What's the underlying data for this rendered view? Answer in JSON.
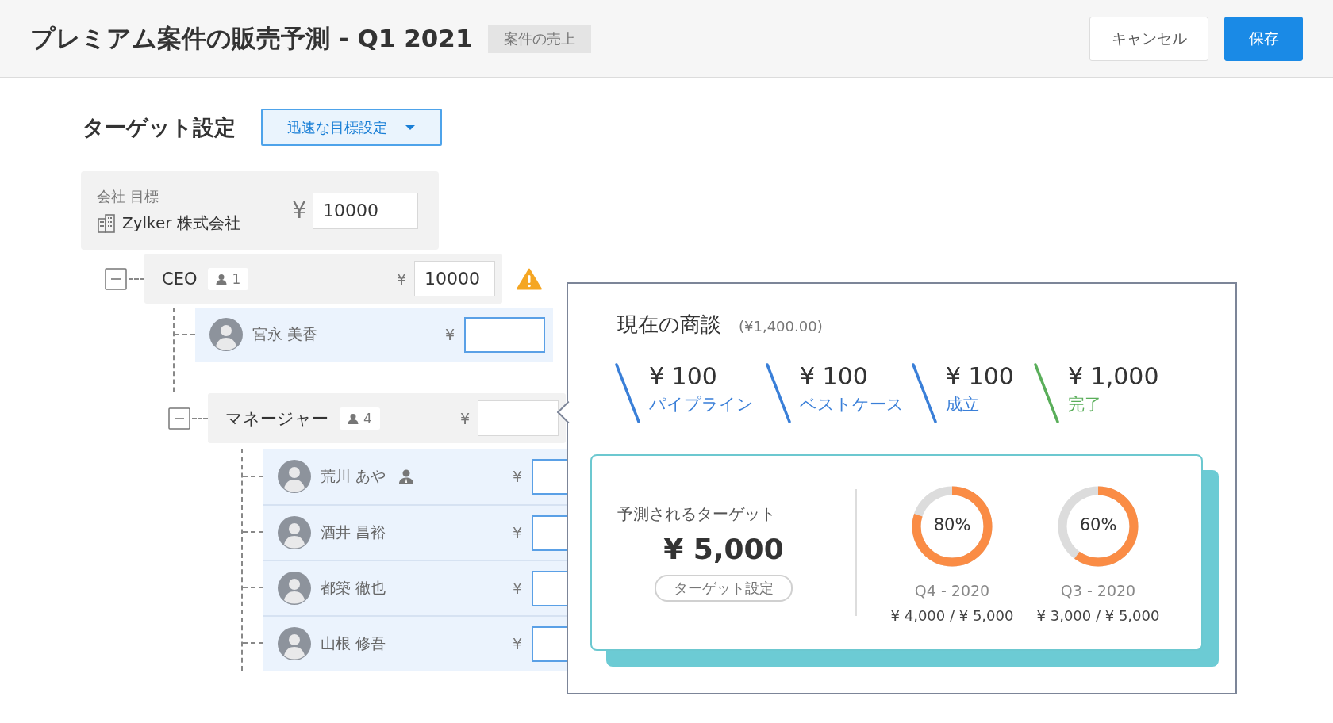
{
  "header": {
    "title": "プレミアム案件の販売予測 - Q1 2021",
    "tag": "案件の売上",
    "buttons": [
      {
        "label": "キャンセル",
        "kind": "secondary"
      },
      {
        "label": "保存",
        "kind": "primary"
      }
    ]
  },
  "target_section": {
    "title": "ターゲット設定",
    "quick_set": "迅速な目標設定"
  },
  "company": {
    "label": "会社 目標",
    "name": "Zylker 株式会社",
    "currency": "¥",
    "value": "10000"
  },
  "tree": [
    {
      "kind": "role",
      "name": "CEO",
      "count": "1",
      "currency": "¥",
      "value": "10000",
      "warning": true,
      "expanded": true,
      "children": [
        {
          "kind": "user",
          "name": "宮永 美香",
          "currency": "¥",
          "lead": false
        },
        {
          "kind": "role",
          "name": "マネージャー",
          "count": "4",
          "currency": "¥",
          "warning": false,
          "expanded": true,
          "children": [
            {
              "kind": "user",
              "name": "荒川 あや",
              "currency": "¥",
              "lead": true
            },
            {
              "kind": "user",
              "name": "酒井 昌裕",
              "currency": "¥",
              "lead": false
            },
            {
              "kind": "user",
              "name": "都築 徹也",
              "currency": "¥",
              "lead": false
            },
            {
              "kind": "user",
              "name": "山根 修吾",
              "currency": "¥",
              "lead": false
            }
          ]
        }
      ]
    }
  ],
  "popover": {
    "title": "現在の商談",
    "total": "(¥1,400.00)",
    "stats": [
      {
        "amount": "¥ 100",
        "label": "パイプライン",
        "color": "#3a7fd8"
      },
      {
        "amount": "¥ 100",
        "label": "ベストケース",
        "color": "#3a7fd8"
      },
      {
        "amount": "¥ 100",
        "label": "成立",
        "color": "#3a7fd8"
      },
      {
        "amount": "¥ 1,000",
        "label": "完了",
        "color": "#5aae5a"
      }
    ],
    "forecast": {
      "label": "予測されるターゲット",
      "amount": "¥ 5,000",
      "button": "ターゲット設定",
      "rings": [
        {
          "percent": "80%",
          "level": 0.8,
          "period": "Q4 - 2020",
          "amounts": "¥ 4,000 / ¥ 5,000"
        },
        {
          "percent": "60%",
          "level": 0.6,
          "period": "Q3 - 2020",
          "amounts": "¥ 3,000 / ¥ 5,000"
        }
      ]
    }
  }
}
